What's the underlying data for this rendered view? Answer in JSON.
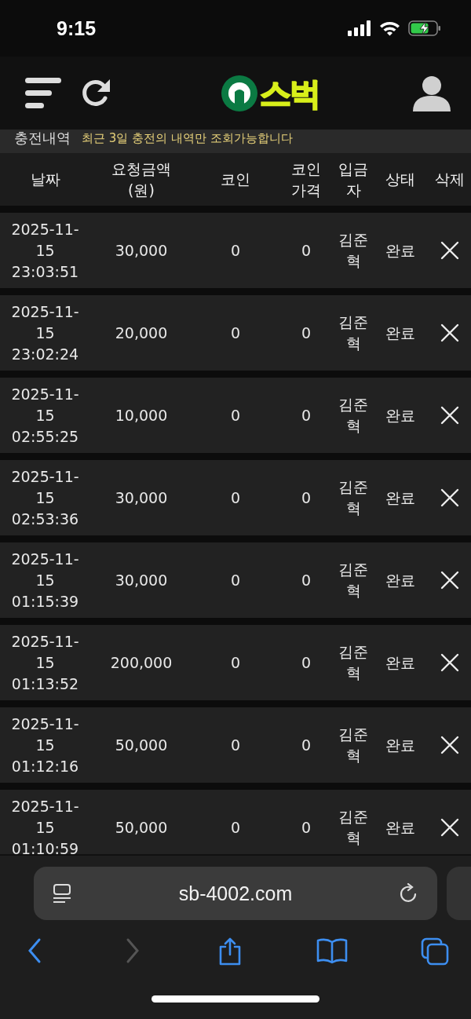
{
  "status_bar": {
    "time": "9:15"
  },
  "header": {
    "logo_text": "스벅"
  },
  "section": {
    "title": "충전내역",
    "note": "최근 3일 충전의 내역만 조회가능합니다"
  },
  "table": {
    "columns": [
      [
        "날짜"
      ],
      [
        "요청금액",
        "(원)"
      ],
      [
        "코인"
      ],
      [
        "코인",
        "가격"
      ],
      [
        "입금",
        "자"
      ],
      [
        "상태"
      ],
      [
        "삭제"
      ]
    ],
    "rows": [
      {
        "date": [
          "2025-11-",
          "15",
          "23:03:51"
        ],
        "amount": "30,000",
        "coin": "0",
        "coin_price": "0",
        "depositor": [
          "김준",
          "혁"
        ],
        "status": "완료"
      },
      {
        "date": [
          "2025-11-",
          "15",
          "23:02:24"
        ],
        "amount": "20,000",
        "coin": "0",
        "coin_price": "0",
        "depositor": [
          "김준",
          "혁"
        ],
        "status": "완료"
      },
      {
        "date": [
          "2025-11-",
          "15",
          "02:55:25"
        ],
        "amount": "10,000",
        "coin": "0",
        "coin_price": "0",
        "depositor": [
          "김준",
          "혁"
        ],
        "status": "완료"
      },
      {
        "date": [
          "2025-11-",
          "15",
          "02:53:36"
        ],
        "amount": "30,000",
        "coin": "0",
        "coin_price": "0",
        "depositor": [
          "김준",
          "혁"
        ],
        "status": "완료"
      },
      {
        "date": [
          "2025-11-",
          "15",
          "01:15:39"
        ],
        "amount": "30,000",
        "coin": "0",
        "coin_price": "0",
        "depositor": [
          "김준",
          "혁"
        ],
        "status": "완료"
      },
      {
        "date": [
          "2025-11-",
          "15",
          "01:13:52"
        ],
        "amount": "200,000",
        "coin": "0",
        "coin_price": "0",
        "depositor": [
          "김준",
          "혁"
        ],
        "status": "완료"
      },
      {
        "date": [
          "2025-11-",
          "15",
          "01:12:16"
        ],
        "amount": "50,000",
        "coin": "0",
        "coin_price": "0",
        "depositor": [
          "김준",
          "혁"
        ],
        "status": "완료"
      },
      {
        "date": [
          "2025-11-",
          "15",
          "01:10:59"
        ],
        "amount": "50,000",
        "coin": "0",
        "coin_price": "0",
        "depositor": [
          "김준",
          "혁"
        ],
        "status": "완료"
      }
    ]
  },
  "browser": {
    "url": "sb-4002.com",
    "forward_disabled": true
  }
}
